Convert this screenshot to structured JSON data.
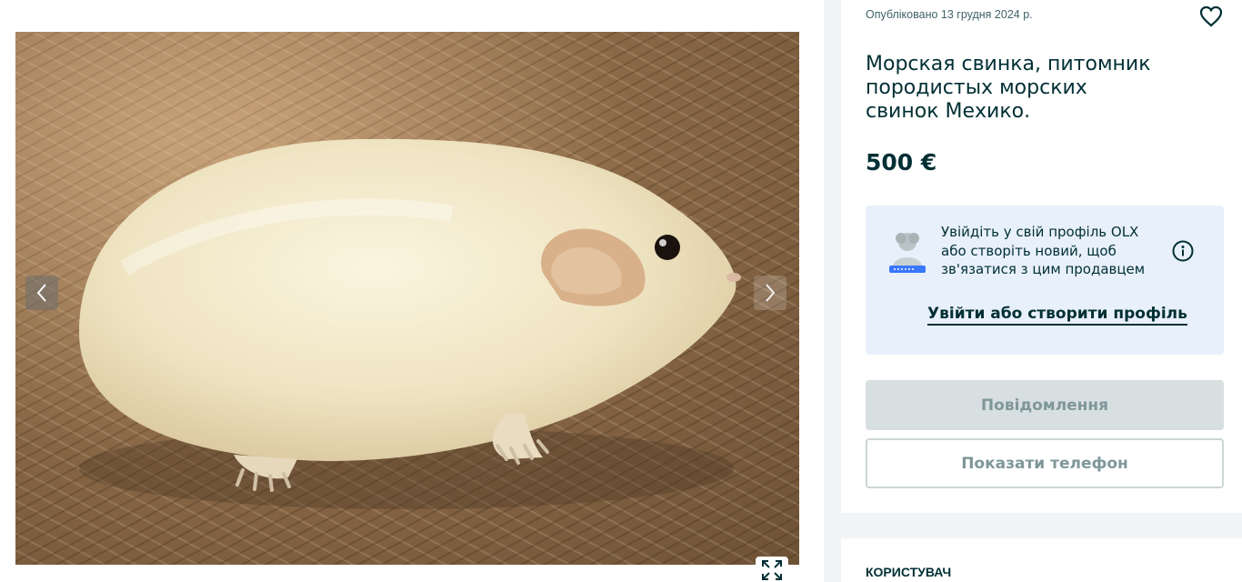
{
  "listing": {
    "posted_date": "Опубліковано 13 грудня 2024 р.",
    "title": "Морская свинка, питомник породистых морских свинок Мехико.",
    "price": "500 €"
  },
  "login_prompt": {
    "text": "Увійдіть у свій профіль OLX або створіть новий, щоб зв'язатися з цим продавцем",
    "link_label": "Увійти або створити профіль"
  },
  "actions": {
    "message_label": "Повідомлення",
    "phone_label": "Показати телефон"
  },
  "user_section": {
    "heading": "КОРИСТУВАЧ"
  },
  "icons": {
    "prev": "chevron-left-icon",
    "next": "chevron-right-icon",
    "fullscreen": "expand-icon",
    "favorite": "heart-icon",
    "info": "info-icon",
    "avatar": "user-avatar-icon"
  },
  "colors": {
    "brand_text": "#002f34",
    "login_box_bg": "#e8f0fc",
    "disabled_button_bg": "#d8dfe0"
  }
}
